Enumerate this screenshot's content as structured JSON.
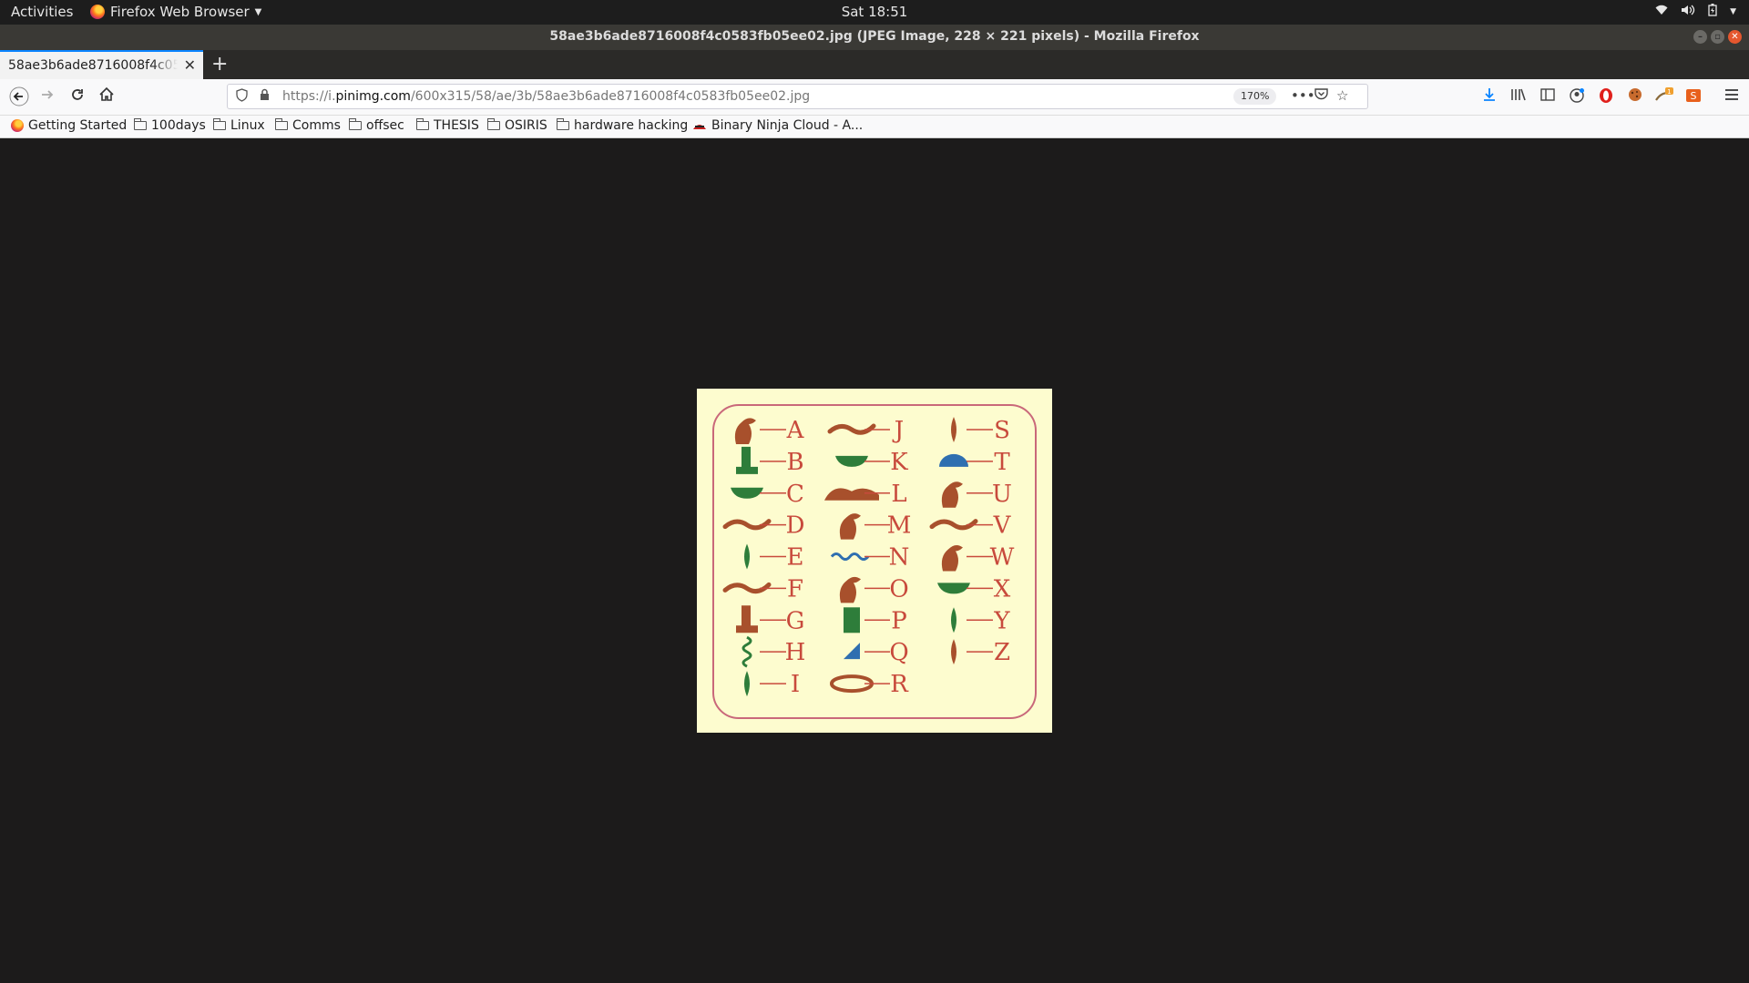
{
  "topbar": {
    "activities": "Activities",
    "app_name": "Firefox Web Browser",
    "clock": "Sat 18:51"
  },
  "window": {
    "title": "58ae3b6ade8716008f4c0583fb05ee02.jpg (JPEG Image, 228 × 221 pixels) - Mozilla Firefox"
  },
  "tabs": [
    {
      "label": "58ae3b6ade8716008f4c0583fb05ee02.jpg"
    }
  ],
  "urlbar": {
    "url_prefix": "https://i.",
    "url_domain": "pinimg.com",
    "url_path": "/600x315/58/ae/3b/58ae3b6ade8716008f4c0583fb05ee02.jpg",
    "zoom": "170%"
  },
  "bookmarks": [
    {
      "label": "Getting Started",
      "icon": "firefox-icon"
    },
    {
      "label": "100days",
      "icon": "folder-icon"
    },
    {
      "label": "Linux",
      "icon": "folder-icon"
    },
    {
      "label": "Comms",
      "icon": "folder-icon"
    },
    {
      "label": "offsec",
      "icon": "folder-icon"
    },
    {
      "label": "THESIS",
      "icon": "folder-icon"
    },
    {
      "label": "OSIRIS",
      "icon": "folder-icon"
    },
    {
      "label": "hardware hacking",
      "icon": "folder-icon"
    },
    {
      "label": "Binary Ninja Cloud - A...",
      "icon": "binja-icon"
    }
  ],
  "image": {
    "letters": [
      "A",
      "B",
      "C",
      "D",
      "E",
      "F",
      "G",
      "H",
      "I",
      "J",
      "K",
      "L",
      "M",
      "N",
      "O",
      "P",
      "Q",
      "R",
      "S",
      "T",
      "U",
      "V",
      "W",
      "X",
      "Y",
      "Z"
    ],
    "colors": {
      "background": "#fdfccf",
      "border": "#c9687a",
      "letters": "#c84a3c",
      "green": "#2e7d3a",
      "brown": "#a8502c",
      "blue": "#2f6fb0"
    }
  },
  "colors": {
    "accent": "#0a84ff",
    "viewer_bg": "#1c1b1b"
  }
}
